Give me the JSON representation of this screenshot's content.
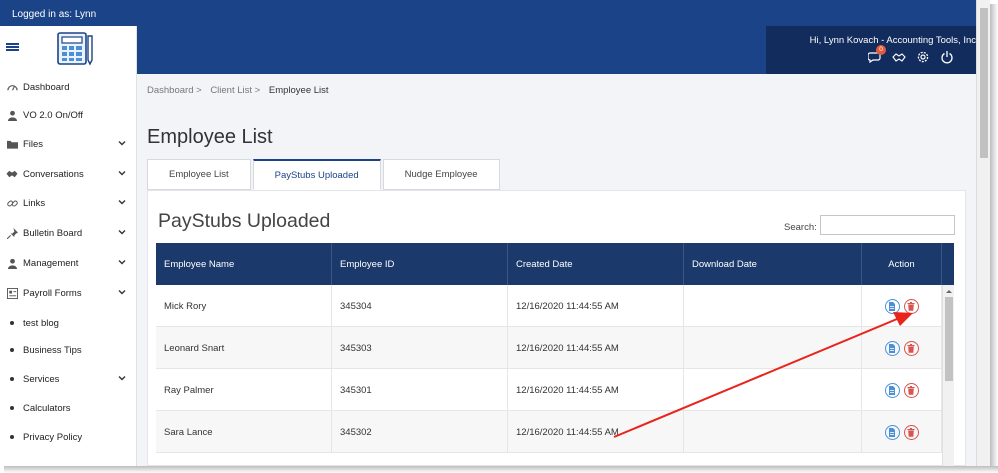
{
  "topbar": {
    "logged_in_text": "Logged in as: Lynn"
  },
  "header": {
    "greeting": "Hi, Lynn Kovach - Accounting Tools, Inc",
    "notification_count": "0"
  },
  "sidebar": {
    "items": [
      {
        "label": "Dashboard",
        "icon": "gauge-icon"
      },
      {
        "label": "VO 2.0 On/Off",
        "icon": "user-icon"
      },
      {
        "label": "Files",
        "icon": "folder-icon",
        "expandable": true
      },
      {
        "label": "Conversations",
        "icon": "handshake-icon",
        "expandable": true
      },
      {
        "label": "Links",
        "icon": "link-icon",
        "expandable": true
      },
      {
        "label": "Bulletin Board",
        "icon": "pin-icon",
        "expandable": true
      },
      {
        "label": "Management",
        "icon": "user-tie-icon",
        "expandable": true
      },
      {
        "label": "Payroll Forms",
        "icon": "form-icon",
        "expandable": true
      },
      {
        "label": "test blog",
        "icon": "bullet"
      },
      {
        "label": "Business Tips",
        "icon": "bullet"
      },
      {
        "label": "Services",
        "icon": "bullet",
        "expandable": true
      },
      {
        "label": "Calculators",
        "icon": "bullet"
      },
      {
        "label": "Privacy Policy",
        "icon": "bullet"
      }
    ]
  },
  "breadcrumb": {
    "items": [
      "Dashboard >",
      "Client List >"
    ],
    "current": "Employee List"
  },
  "page": {
    "title": "Employee List"
  },
  "tabs": [
    {
      "label": "Employee List",
      "active": false
    },
    {
      "label": "PayStubs Uploaded",
      "active": true
    },
    {
      "label": "Nudge Employee",
      "active": false
    }
  ],
  "panel": {
    "title": "PayStubs Uploaded",
    "search_label": "Search:",
    "search_value": ""
  },
  "table": {
    "columns": [
      "Employee Name",
      "Employee ID",
      "Created Date",
      "Download Date",
      "Action"
    ],
    "rows": [
      {
        "name": "Mick Rory",
        "id": "345304",
        "created": "12/16/2020 11:44:55 AM",
        "downloaded": ""
      },
      {
        "name": "Leonard Snart",
        "id": "345303",
        "created": "12/16/2020 11:44:55 AM",
        "downloaded": ""
      },
      {
        "name": "Ray Palmer",
        "id": "345301",
        "created": "12/16/2020 11:44:55 AM",
        "downloaded": ""
      },
      {
        "name": "Sara Lance",
        "id": "345302",
        "created": "12/16/2020 11:44:55 AM",
        "downloaded": ""
      }
    ]
  },
  "colors": {
    "brand": "#1b4387",
    "table_header": "#1b3a6b",
    "header_dark": "#122d5d",
    "annotation_arrow": "#e8241c",
    "delete": "#d9534f",
    "view": "#4a8fd8"
  }
}
